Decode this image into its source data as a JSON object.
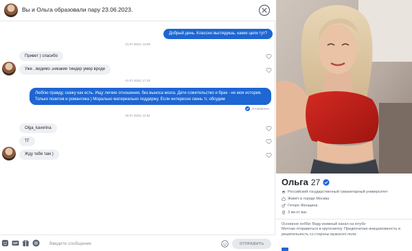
{
  "header": {
    "title": "Вы и Ольга образовали пару 23.06.2023."
  },
  "messages": [
    {
      "type": "out",
      "text": "Добрый день. Классно выглядишь, какие цели тут?"
    },
    {
      "type": "date",
      "text": "01.07.2023, 13:08"
    },
    {
      "type": "in",
      "text": "Привет ) спасибо"
    },
    {
      "type": "in",
      "text": "Уже , видимо ,никакие тиндер умер вроде"
    },
    {
      "type": "date",
      "text": "01.07.2023, 17:33"
    },
    {
      "type": "out",
      "text": "Люблю правду, скажу как есть. Ищу легкие отношения, без выноса мозга. Дети сожительство и брак - не моя история. Только позитив и романтика ) Морально материально поддержу. Если интересно скинь тг, обсудим"
    },
    {
      "type": "status",
      "text": "Отправлено"
    },
    {
      "type": "date",
      "text": "02.07.2023, 12:54"
    },
    {
      "type": "in",
      "text": "Olga_kaverina"
    },
    {
      "type": "in",
      "text": "ТГ"
    },
    {
      "type": "in",
      "text": "Жду тебя там )"
    }
  ],
  "composer": {
    "placeholder": "Введите сообщение",
    "send_label": "ОТПРАВИТЬ",
    "tools": [
      "sticker-icon",
      "gif-icon",
      "gift-icon",
      "list-icon"
    ]
  },
  "profile": {
    "name": "Ольга",
    "age": "27",
    "details": [
      {
        "icon": "graduation-icon",
        "text": "Российский государственный гуманитарный университет"
      },
      {
        "icon": "home-icon",
        "text": "Живёт в городе Москва"
      },
      {
        "icon": "gender-icon",
        "text": "Гетеро Женщина"
      },
      {
        "icon": "location-icon",
        "text": "3 км от вас"
      }
    ],
    "about": [
      "Основное хобби: Веду книжный канал на ютубе",
      "Мечтаю отправиться в кругосветку. Предпочитаю инициативность и решительность со стороны мужского пола."
    ]
  },
  "colors": {
    "accent": "#1e66d2",
    "incoming_bubble": "#eef0f3",
    "muted_text": "#8c929c"
  }
}
